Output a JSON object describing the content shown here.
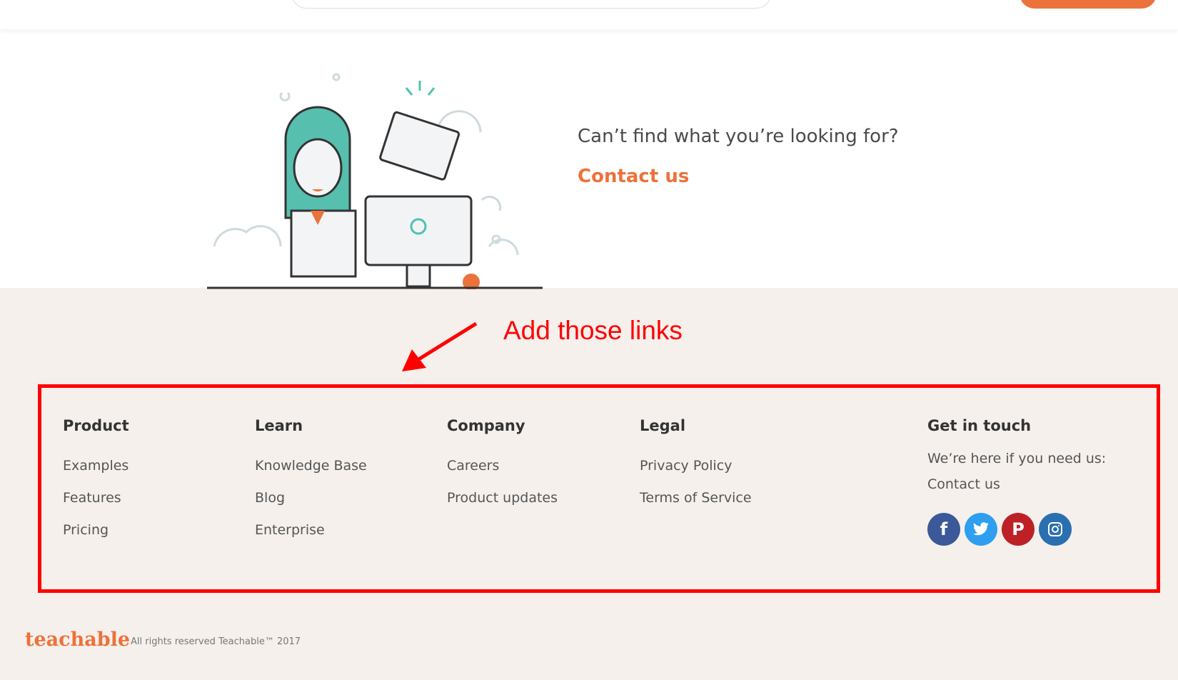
{
  "header": {
    "search_placeholder": "",
    "cta_label": ""
  },
  "help": {
    "question": "Can’t find what you’re looking for?",
    "contact_label": "Contact us"
  },
  "annotation": {
    "text": "Add those links",
    "color": "#ff0000"
  },
  "footer": {
    "columns": [
      {
        "title": "Product",
        "links": [
          "Examples",
          "Features",
          "Pricing"
        ]
      },
      {
        "title": "Learn",
        "links": [
          "Knowledge Base",
          "Blog",
          "Enterprise"
        ]
      },
      {
        "title": "Company",
        "links": [
          "Careers",
          "Product updates"
        ]
      },
      {
        "title": "Legal",
        "links": [
          "Privacy Policy",
          "Terms of Service"
        ]
      }
    ],
    "get_in_touch": {
      "title": "Get in touch",
      "text": "We’re here if you need us:",
      "contact_label": "Contact us",
      "social": [
        {
          "icon": "facebook-icon",
          "glyph": "f",
          "color": "#3b5998"
        },
        {
          "icon": "twitter-icon",
          "glyph": "t",
          "color": "#2d9ef0"
        },
        {
          "icon": "pinterest-icon",
          "glyph": "P",
          "color": "#bd2126"
        },
        {
          "icon": "instagram-icon",
          "glyph": "◎",
          "color": "#2a6fb0"
        }
      ]
    },
    "logo": "teachable",
    "copyright": "All rights reserved Teachable™ 2017"
  },
  "colors": {
    "brand": "#ec723b",
    "footer_bg": "#f5f0ec"
  }
}
